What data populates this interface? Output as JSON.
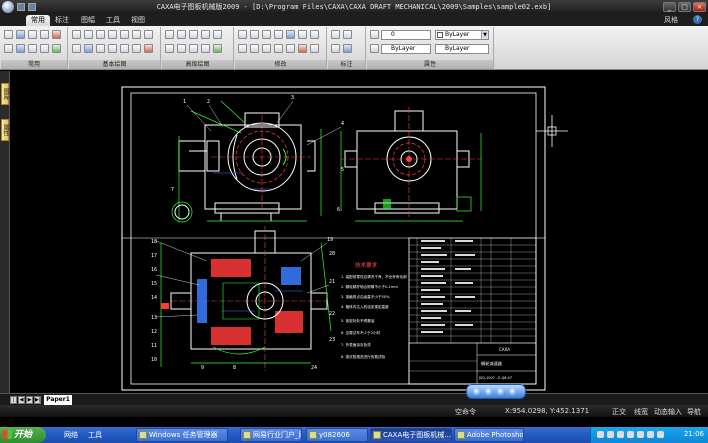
{
  "window": {
    "title": "CAXA电子图板机械版2009 - [D:\\Program Files\\CAXA\\CAXA DRAFT MECHANICAL\\2009\\Samples\\sample02.exb]",
    "min": "_",
    "max": "□",
    "close": "×"
  },
  "ribbon": {
    "tabs": [
      "常用",
      "标注",
      "图幅",
      "工具",
      "视图"
    ],
    "active_tab": "常用",
    "style_label": "风格",
    "help": "?",
    "groups": [
      "常用",
      "基本绘图",
      "高级绘图",
      "修改",
      "标注",
      "属性"
    ],
    "layer_combo": "0",
    "color_combo": "ByLayer",
    "linetype_combo": "ByLayer",
    "lineweight_combo": "ByLayer"
  },
  "left_panel": {
    "tab1": "图库",
    "tab2": "属性"
  },
  "drawing": {
    "tech_title": "技术要求",
    "titleblock_name": "蜗轮减速器",
    "titleblock_code": "JSQ-1007 - E-Q6-07",
    "company": "CAXA",
    "callouts_top": [
      "1",
      "2",
      "3",
      "4",
      "5",
      "6",
      "7"
    ],
    "callouts_left": [
      "18",
      "17",
      "16",
      "15",
      "14",
      "13",
      "12",
      "11",
      "10",
      "9",
      "8"
    ],
    "callouts_right": [
      "19",
      "20",
      "21",
      "22",
      "23",
      "24"
    ],
    "tech_notes": [
      "1. 装配前零件应清洗干净，不允许有毛刺",
      "2. 蜗轮蜗杆啮合侧隙不小于0.1mm",
      "3. 接触斑点沿齿高不小于50%",
      "4. 箱体内注入机油至规定高度",
      "5. 各密封处不得漏油",
      "6. 空载试车不少于2小时",
      "7. 外表面涂灰色漆",
      "8. 按试验规范进行负载试验"
    ]
  },
  "sheet": {
    "tab_label": "Paper1"
  },
  "status": {
    "command": "空命令",
    "coords": "X:954.0298, Y:452.1371",
    "mode": "正交",
    "lineweight": "线宽",
    "snap": "动态输入",
    "nav": "导航"
  },
  "taskbar": {
    "start": "开始",
    "toolbar1": "网络",
    "toolbar2": "工具",
    "tasks": [
      "Windows 任务管理器",
      "网易行业门户_网...",
      "y082606",
      "CAXA电子图板机械...",
      "Adobe Photoshop ..."
    ],
    "active_task": "CAXA电子图板机械...",
    "clock": "21:06"
  }
}
